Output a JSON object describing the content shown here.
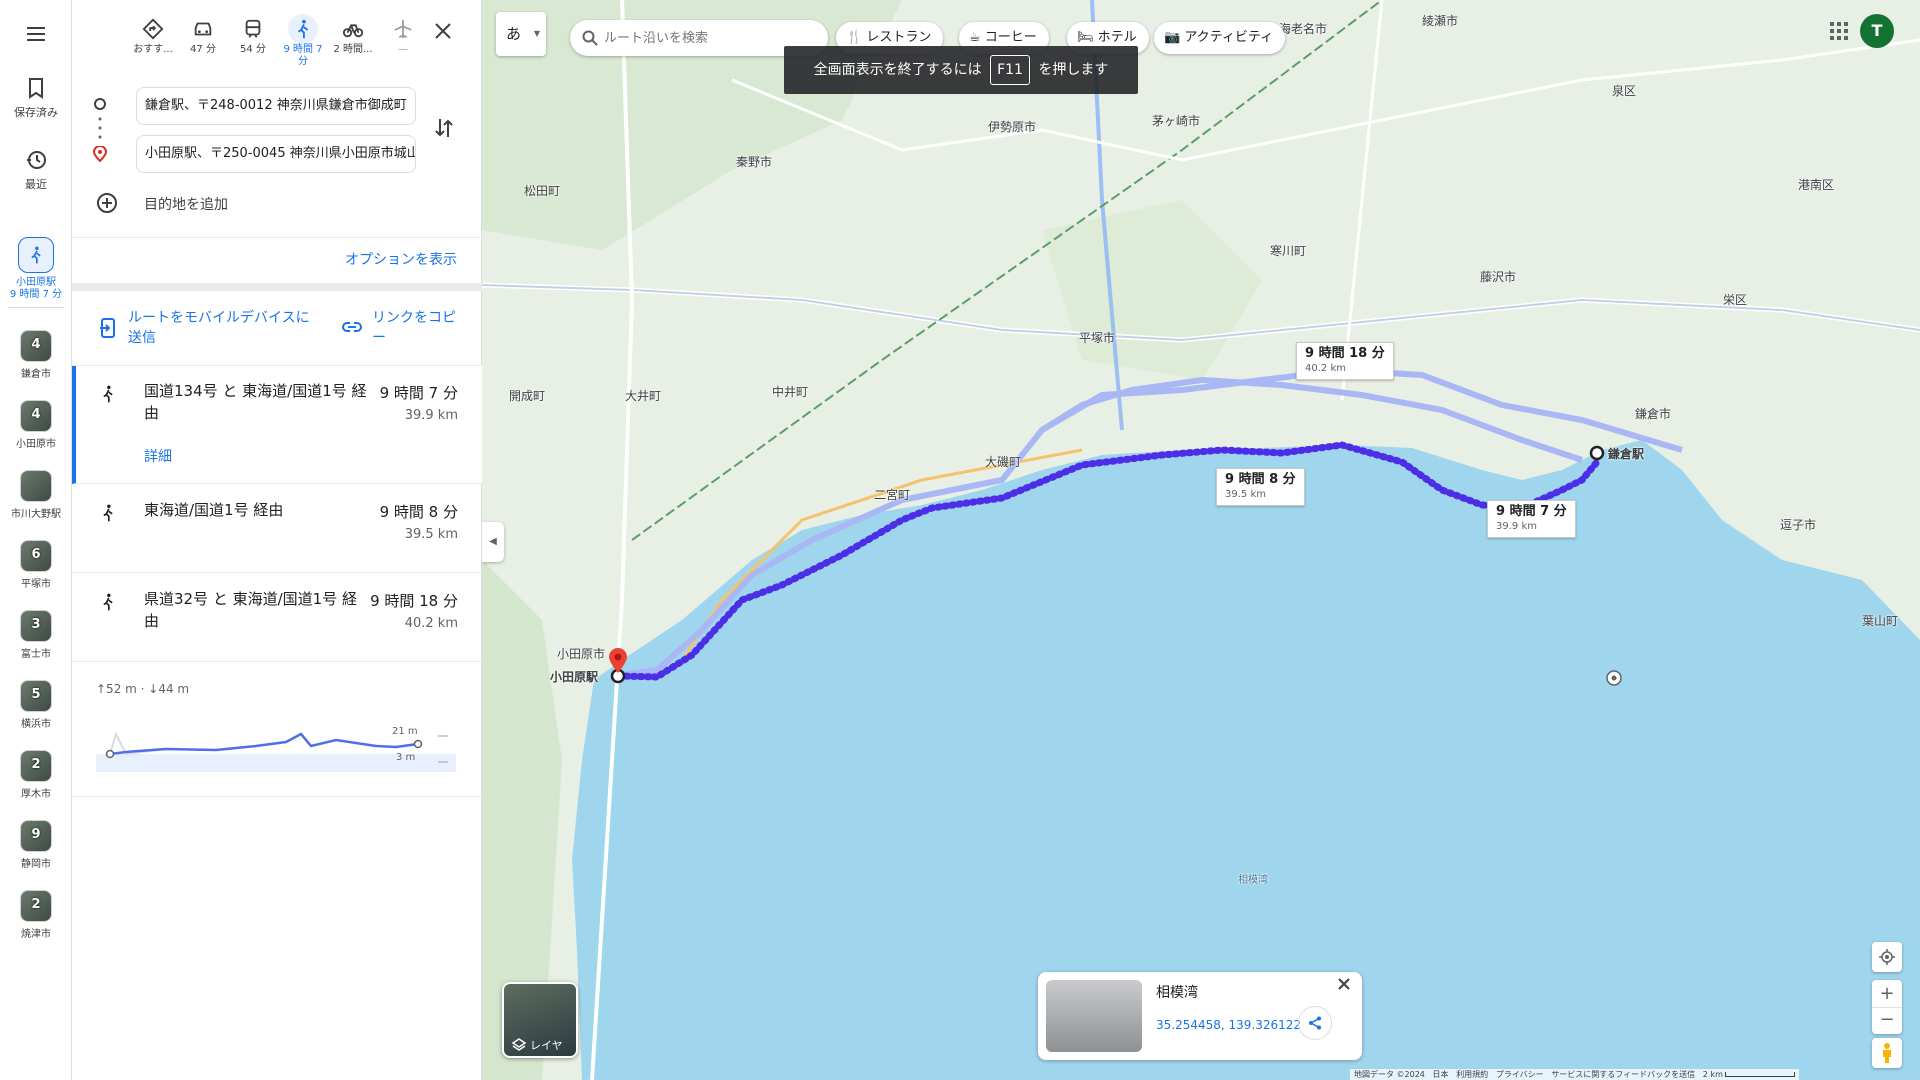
{
  "rail": {
    "saved": "保存済み",
    "recent": "最近",
    "current": {
      "line1": "小田原駅",
      "line2": "9 時間 7 分"
    },
    "history": [
      {
        "label": "鎌倉市",
        "badge": "4"
      },
      {
        "label": "小田原市",
        "badge": "4"
      },
      {
        "label": "市川大野駅",
        "badge": ""
      },
      {
        "label": "平塚市",
        "badge": "6"
      },
      {
        "label": "富士市",
        "badge": "3"
      },
      {
        "label": "横浜市",
        "badge": "5"
      },
      {
        "label": "厚木市",
        "badge": "2"
      },
      {
        "label": "静岡市",
        "badge": "9"
      },
      {
        "label": "焼津市",
        "badge": "2"
      }
    ]
  },
  "modes": [
    {
      "icon": "best-route-icon",
      "label": "おすす..."
    },
    {
      "icon": "car-icon",
      "label": "47 分"
    },
    {
      "icon": "train-icon",
      "label": "54 分"
    },
    {
      "icon": "walk-icon",
      "label": "9 時間 7 分"
    },
    {
      "icon": "bicycle-icon",
      "label": "2 時間..."
    },
    {
      "icon": "flight-icon",
      "label": "—"
    }
  ],
  "origin": "鎌倉駅、〒248-0012 神奈川県鎌倉市御成町",
  "destination": "小田原駅、〒250-0045 神奈川県小田原市城山",
  "add_destination": "目的地を追加",
  "options": "オプションを表示",
  "send_to_device": "ルートをモバイルデバイスに送信",
  "copy_link": "リンクをコピー",
  "routes": [
    {
      "name": "国道134号 と 東海道/国道1号 経由",
      "time": "9 時間 7 分",
      "distance": "39.9 km",
      "details": "詳細"
    },
    {
      "name": "東海道/国道1号 経由",
      "time": "9 時間 8 分",
      "distance": "39.5 km"
    },
    {
      "name": "県道32号 と 東海道/国道1号 経由",
      "time": "9 時間 18 分",
      "distance": "40.2 km"
    }
  ],
  "elevation": {
    "up": "↑52 m",
    "down": "↓44 m",
    "max": "21 m",
    "min": "3 m"
  },
  "map": {
    "ime": "あ",
    "search_placeholder": "ルート沿いを検索",
    "chips": [
      "レストラン",
      "コーヒー",
      "ホテル",
      "アクティビティ"
    ],
    "fullscreen_pre": "全画面表示を終了するには",
    "fullscreen_key": "F11",
    "fullscreen_post": "を押します",
    "avatar": "T",
    "labels": [
      {
        "time": "9 時間 18 分",
        "dist": "40.2 km"
      },
      {
        "time": "9 時間 8 分",
        "dist": "39.5 km"
      },
      {
        "time": "9 時間 7 分",
        "dist": "39.9 km"
      }
    ],
    "places": [
      "綾瀬市",
      "海老名市",
      "伊勢原市",
      "秦野市",
      "松田町",
      "開成町",
      "大井町",
      "中井町",
      "平塚市",
      "寒川町",
      "藤沢市",
      "大磯町",
      "二宮町",
      "小田原市",
      "小田原駅",
      "鎌倉市",
      "鎌倉駅",
      "逗子市",
      "港南区",
      "栄区",
      "泉区",
      "葉山町",
      "相模湾",
      "茅ヶ崎市"
    ],
    "layer": "レイヤ",
    "info": {
      "title": "相模湾",
      "coords": "35.254458, 139.326122"
    },
    "footer": [
      "地図データ ©2024",
      "日本",
      "利用規約",
      "プライバシー",
      "サービスに関するフィードバックを送信",
      "2 km"
    ]
  },
  "colors": {
    "route": "#4b2ee6",
    "alt": "#a9b7f5",
    "sea": "#9fd6ee",
    "land": "#e8efe4",
    "accent": "#1a73e8"
  }
}
